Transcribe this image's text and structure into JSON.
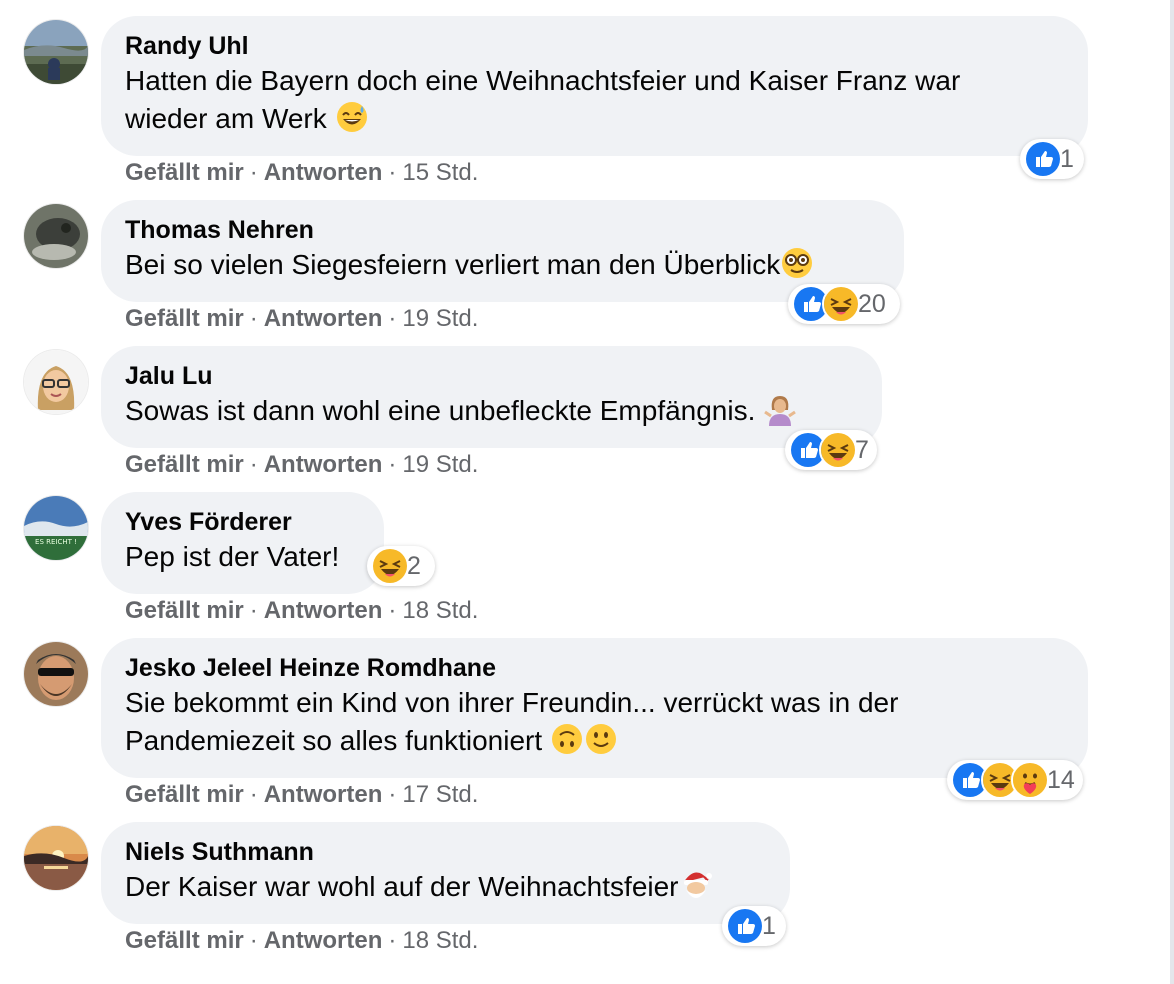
{
  "comments": [
    {
      "author": "Randy Uhl",
      "line1": "Hatten die Bayern doch eine Weihnachtsfeier und Kaiser Franz war",
      "line2": "wieder am Werk",
      "emoji": "grinning-sweat-emoji",
      "reaction_icons": [
        "like-icon"
      ],
      "reaction_count": "1",
      "like": "Gefällt mir",
      "reply": "Antworten",
      "time": "15 Std."
    },
    {
      "author": "Thomas Nehren",
      "line1": "Bei so vielen Siegesfeiern verliert man den Überblick",
      "emoji": "nerd-glasses-emoji",
      "reaction_icons": [
        "like-icon",
        "haha-icon"
      ],
      "reaction_count": "20",
      "like": "Gefällt mir",
      "reply": "Antworten",
      "time": "19 Std."
    },
    {
      "author": "Jalu Lu",
      "line1": "Sowas ist dann wohl eine unbefleckte Empfängnis.",
      "emoji": "woman-shrugging-emoji",
      "reaction_icons": [
        "like-icon",
        "haha-icon"
      ],
      "reaction_count": "7",
      "like": "Gefällt mir",
      "reply": "Antworten",
      "time": "19 Std."
    },
    {
      "author": "Yves Förderer",
      "line1": "Pep ist der Vater!",
      "avatar_text": "ES REICHT !",
      "reaction_icons": [
        "haha-icon"
      ],
      "reaction_count": "2",
      "like": "Gefällt mir",
      "reply": "Antworten",
      "time": "18 Std."
    },
    {
      "author": "Jesko Jeleel Heinze Romdhane",
      "line1": "Sie bekommt ein Kind von ihrer Freundin... verrückt was in der",
      "line2": "Pandemiezeit so alles funktioniert",
      "emoji": "upside-down-and-smiling-emoji",
      "reaction_icons": [
        "like-icon",
        "haha-icon",
        "care-icon"
      ],
      "reaction_count": "14",
      "like": "Gefällt mir",
      "reply": "Antworten",
      "time": "17 Std."
    },
    {
      "author": "Niels Suthmann",
      "line1": "Der Kaiser war wohl auf der Weihnachtsfeier",
      "emoji": "santa-emoji",
      "reaction_icons": [
        "like-icon"
      ],
      "reaction_count": "1",
      "like": "Gefällt mir",
      "reply": "Antworten",
      "time": "18 Std."
    }
  ],
  "separator": "·",
  "colors": {
    "bubble": "#f0f2f5",
    "meta": "#65676b",
    "like_blue": "#1877f2",
    "haha_yellow": "#f7b928"
  }
}
